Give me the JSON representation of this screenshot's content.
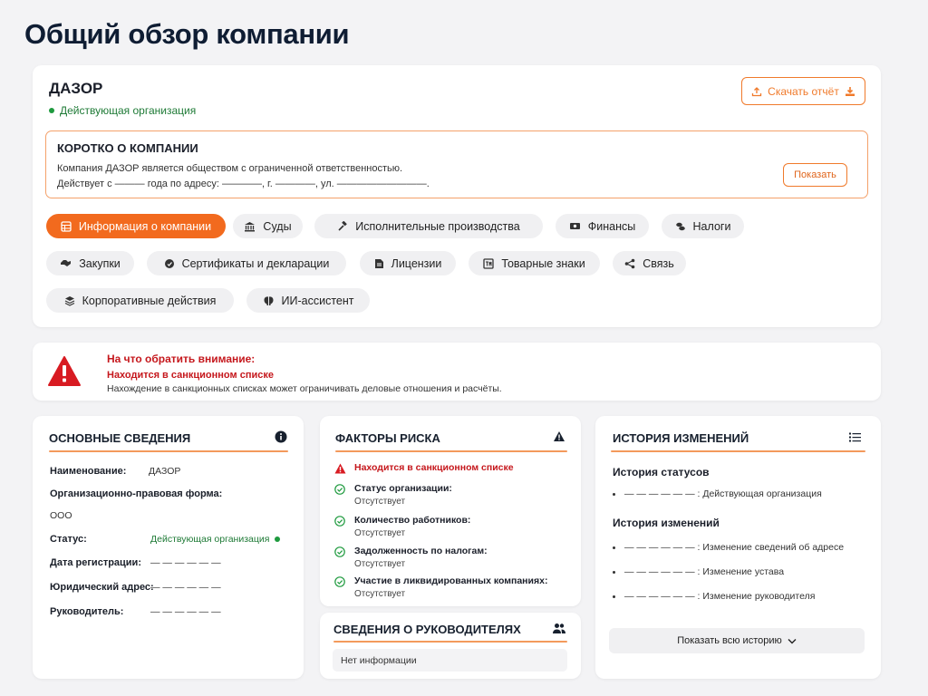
{
  "page": {
    "title": "Общий обзор компании"
  },
  "company": {
    "name": "ДАЗОР",
    "status": "Действующая организация",
    "download_label": "Скачать отчёт"
  },
  "about": {
    "title": "КОРОТКО О КОМПАНИИ",
    "line1": "Компания ДАЗОР является обществом с ограниченной ответственностью.",
    "line2": "Действует  с ——— года по адресу: ————, г. ————, ул. —————————.",
    "show_label": "Показать"
  },
  "tabs": [
    {
      "label": "Информация о компании",
      "icon": "table-icon"
    },
    {
      "label": "Суды",
      "icon": "court-icon"
    },
    {
      "label": "Исполнительные производства",
      "icon": "gavel-icon"
    },
    {
      "label": "Финансы",
      "icon": "money-icon"
    },
    {
      "label": "Налоги",
      "icon": "coins-icon"
    },
    {
      "label": "Закупки",
      "icon": "handshake-icon"
    },
    {
      "label": "Сертификаты и декларации",
      "icon": "certificate-icon"
    },
    {
      "label": "Лицензии",
      "icon": "document-icon"
    },
    {
      "label": "Товарные знаки",
      "icon": "trademark-icon"
    },
    {
      "label": "Связь",
      "icon": "share-icon"
    },
    {
      "label": "Корпоративные действия",
      "icon": "layers-icon"
    },
    {
      "label": "ИИ-ассистент",
      "icon": "brain-icon"
    }
  ],
  "alert": {
    "title": "На что обратить внимание:",
    "subtitle": "Находится в санкционном списке",
    "description": "Нахождение в санкционных списках может ограничивать деловые отношения и расчёты."
  },
  "basic": {
    "title": "ОСНОВНЫЕ СВЕДЕНИЯ",
    "rows": [
      {
        "label": "Наименование:",
        "value": "ДАЗОР"
      },
      {
        "label": "Организационно-правовая форма:",
        "value": "ООО"
      },
      {
        "label": "Статус:",
        "value": "Действующая организация"
      },
      {
        "label": "Дата регистрации:",
        "value": "— — — — — —"
      },
      {
        "label": "Юридический адрес:",
        "value": "— — — — — —"
      },
      {
        "label": "Руководитель:",
        "value": "— — — — — —"
      }
    ]
  },
  "risk": {
    "title": "ФАКТОРЫ РИСКА",
    "warning": "Находится в санкционном списке",
    "items": [
      {
        "title": "Статус организации:",
        "value": "Отсутствует"
      },
      {
        "title": "Количество работников:",
        "value": "Отсутствует"
      },
      {
        "title": "Задолженность по налогам:",
        "value": "Отсутствует"
      },
      {
        "title": "Участие в ликвидированных компаниях:",
        "value": "Отсутствует"
      }
    ]
  },
  "managers": {
    "title": "СВЕДЕНИЯ О РУКОВОДИТЕЛЯХ",
    "empty": "Нет информации"
  },
  "history": {
    "title": "ИСТОРИЯ ИЗМЕНЕНИЙ",
    "status_title": "История статусов",
    "status_items": [
      "— — — — — — : Действующая организация"
    ],
    "changes_title": "История изменений",
    "change_items": [
      "— — — — — — : Изменение сведений об адресе",
      "— — — — — — : Изменение устава",
      "— — — — — — : Изменение руководителя"
    ],
    "show_all_label": "Показать всю историю"
  },
  "colors": {
    "accent": "#f26a1e",
    "danger": "#c5171c",
    "success": "#1e9a3e"
  }
}
